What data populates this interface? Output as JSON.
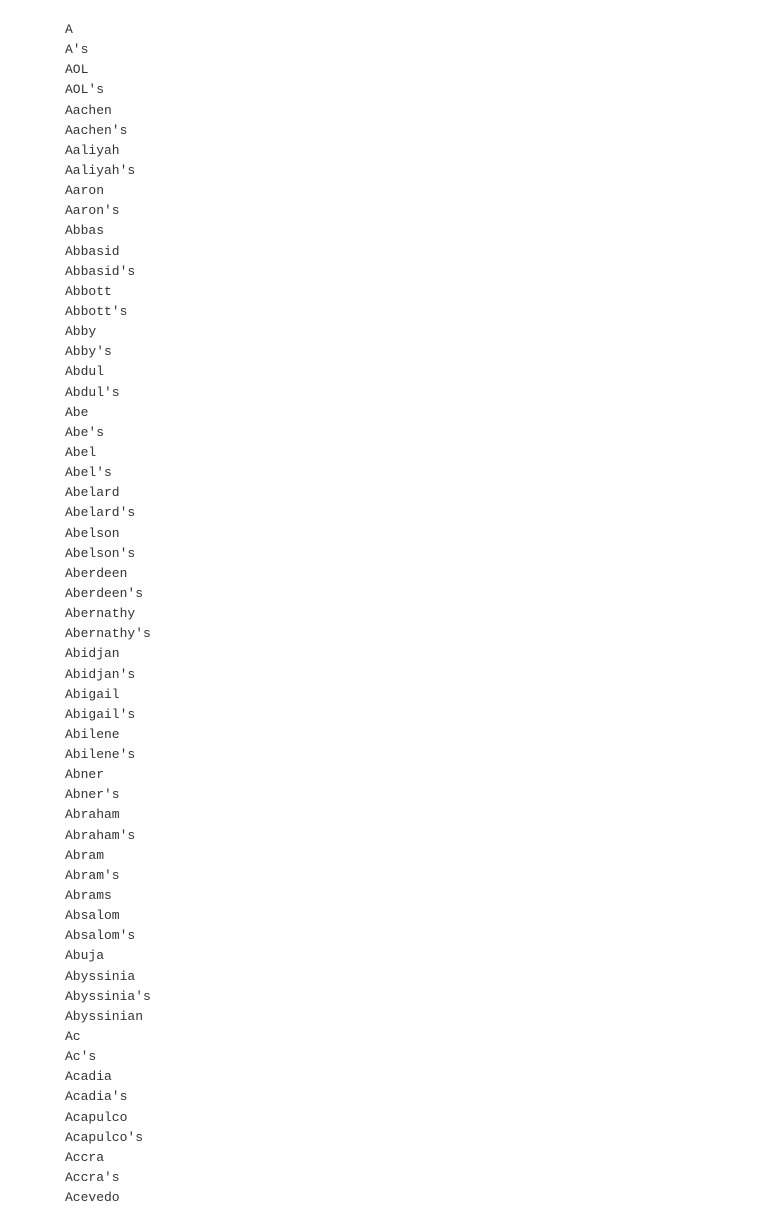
{
  "wordlist": {
    "items": [
      "A",
      "A's",
      "AOL",
      "AOL's",
      "Aachen",
      "Aachen's",
      "Aaliyah",
      "Aaliyah's",
      "Aaron",
      "Aaron's",
      "Abbas",
      "Abbasid",
      "Abbasid's",
      "Abbott",
      "Abbott's",
      "Abby",
      "Abby's",
      "Abdul",
      "Abdul's",
      "Abe",
      "Abe's",
      "Abel",
      "Abel's",
      "Abelard",
      "Abelard's",
      "Abelson",
      "Abelson's",
      "Aberdeen",
      "Aberdeen's",
      "Abernathy",
      "Abernathy's",
      "Abidjan",
      "Abidjan's",
      "Abigail",
      "Abigail's",
      "Abilene",
      "Abilene's",
      "Abner",
      "Abner's",
      "Abraham",
      "Abraham's",
      "Abram",
      "Abram's",
      "Abrams",
      "Absalom",
      "Absalom's",
      "Abuja",
      "Abyssinia",
      "Abyssinia's",
      "Abyssinian",
      "Ac",
      "Ac's",
      "Acadia",
      "Acadia's",
      "Acapulco",
      "Acapulco's",
      "Accra",
      "Accra's",
      "Acevedo"
    ]
  }
}
